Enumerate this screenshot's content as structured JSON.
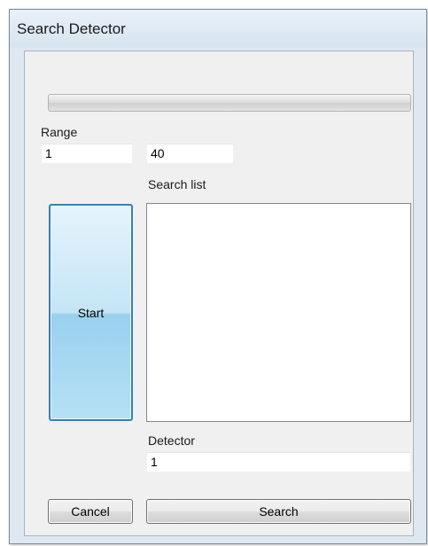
{
  "window": {
    "title": "Search Detector"
  },
  "progress": {
    "value_percent": 0
  },
  "range": {
    "label": "Range",
    "from_value": "1",
    "to_value": "40"
  },
  "search_list": {
    "label": "Search list",
    "items": []
  },
  "start_button": {
    "label": "Start"
  },
  "detector": {
    "label": "Detector",
    "value": "1"
  },
  "buttons": {
    "cancel_label": "Cancel",
    "search_label": "Search"
  },
  "colors": {
    "accent_button_border": "#3c7fb1",
    "accent_button_fill": "#c4e5f6",
    "window_background": "#f0f0f0"
  }
}
